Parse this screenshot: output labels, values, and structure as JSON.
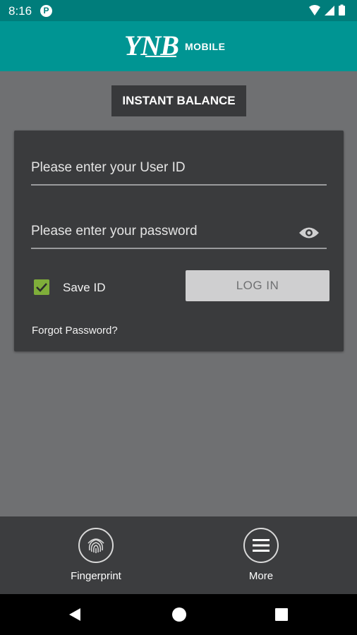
{
  "status_bar": {
    "time": "8:16",
    "notification_badge": "P"
  },
  "header": {
    "logo_text": "YNB",
    "logo_suffix": "MOBILE",
    "background": "#009593"
  },
  "instant_balance_label": "INSTANT BALANCE",
  "login": {
    "user_id": {
      "placeholder": "Please enter your User ID",
      "value": ""
    },
    "password": {
      "placeholder": "Please enter your password",
      "value": "",
      "toggle_icon": "eye-icon"
    },
    "save_id": {
      "label": "Save ID",
      "checked": true,
      "color": "#7fae3a"
    },
    "login_button": "LOG IN",
    "forgot_password": "Forgot Password?"
  },
  "bottom_tabs": [
    {
      "label": "Fingerprint",
      "icon": "fingerprint-icon"
    },
    {
      "label": "More",
      "icon": "menu-icon"
    }
  ],
  "nav": {
    "back_icon": "back-triangle-icon",
    "home_icon": "home-circle-icon",
    "recent_icon": "recent-square-icon"
  }
}
